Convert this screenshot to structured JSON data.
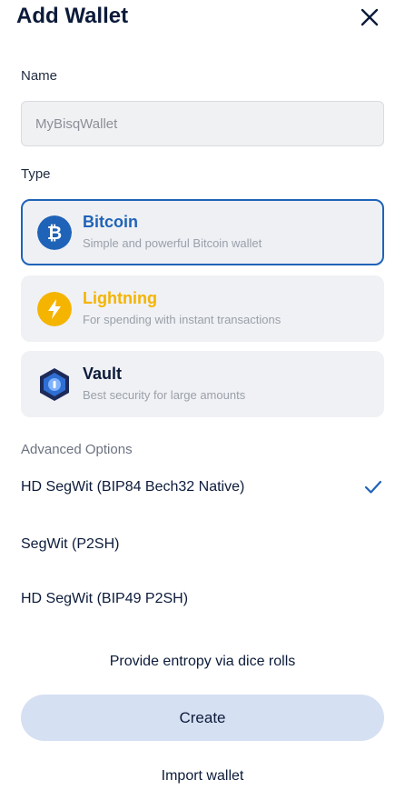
{
  "header": {
    "title": "Add Wallet",
    "close_icon": "close-icon"
  },
  "name": {
    "label": "Name",
    "placeholder": "MyBisqWallet"
  },
  "type": {
    "label": "Type",
    "selected": "Bitcoin",
    "options": [
      {
        "name": "Bitcoin",
        "description": "Simple and powerful Bitcoin wallet",
        "icon": "bitcoin-icon",
        "color": "#1f63b8",
        "icon_bg": "#1f63b8"
      },
      {
        "name": "Lightning",
        "description": "For spending with instant transactions",
        "icon": "lightning-icon",
        "color": "#f4b400",
        "icon_bg": "#f4b400"
      },
      {
        "name": "Vault",
        "description": "Best security for large amounts",
        "icon": "vault-icon",
        "color": "#0c1b3a",
        "icon_bg": "#1d2b5a"
      }
    ]
  },
  "advanced": {
    "label": "Advanced Options",
    "options": [
      {
        "label": "HD SegWit (BIP84 Bech32 Native)",
        "selected": true
      },
      {
        "label": "SegWit (P2SH)",
        "selected": false
      },
      {
        "label": "HD SegWit (BIP49 P2SH)",
        "selected": false
      }
    ],
    "check_icon": "checkmark-icon"
  },
  "actions": {
    "entropy_label": "Provide entropy via dice rolls",
    "create_label": "Create",
    "import_label": "Import wallet"
  },
  "colors": {
    "accent": "#1f63b8",
    "create_button_bg": "#d6e0f3",
    "card_bg": "#f0f1f4",
    "text_primary": "#0c1b3a"
  }
}
